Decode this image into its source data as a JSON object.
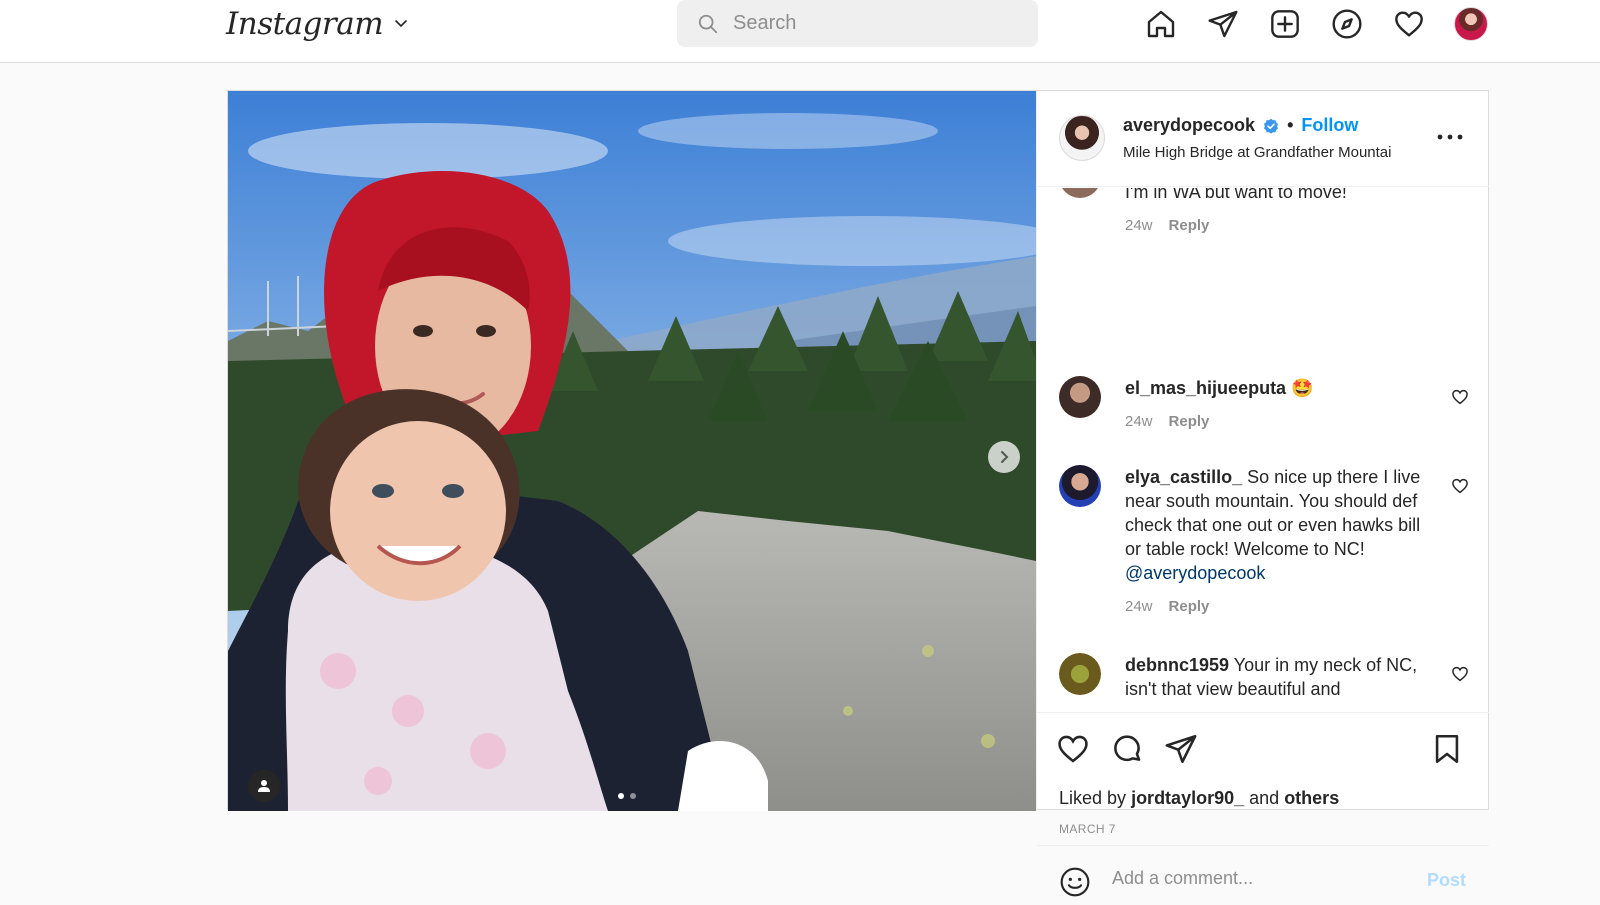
{
  "header": {
    "logo_text": "Instagram",
    "search": {
      "placeholder": "Search"
    },
    "nav_icons": [
      "home-icon",
      "direct-icon",
      "new-post-icon",
      "explore-icon",
      "activity-icon",
      "profile-avatar"
    ]
  },
  "post": {
    "username": "averydopecook",
    "verified": true,
    "separator": "•",
    "follow_label": "Follow",
    "location": "Mile High Bridge at Grandfather Mountai",
    "comments": [
      {
        "user": "",
        "text": "it there?\nI'm in WA but want to move!",
        "time": "24w",
        "reply": "Reply"
      },
      {
        "user": "el_mas_hijueeputa",
        "text": "🤩",
        "time": "24w",
        "reply": "Reply"
      },
      {
        "user": "elya_castillo_",
        "text": "So nice up there I live near south mountain. You should def check that one out or even hawks bill or table rock! Welcome to NC!",
        "mention": "@averydopecook",
        "time": "24w",
        "reply": "Reply"
      },
      {
        "user": "debnnc1959",
        "text": "Your in my neck of NC, isn't that view beautiful and"
      }
    ],
    "liked_by_prefix": "Liked by",
    "liked_by_user": "jordtaylor90_",
    "liked_by_and": "and",
    "liked_by_others": "others",
    "date": "MARCH 7",
    "comment_placeholder": "Add a comment...",
    "post_label": "Post"
  },
  "colors": {
    "accent": "#0095f6",
    "post_disabled": "#b3dbff",
    "muted": "#8e8e8e",
    "border": "#dbdbdb"
  }
}
